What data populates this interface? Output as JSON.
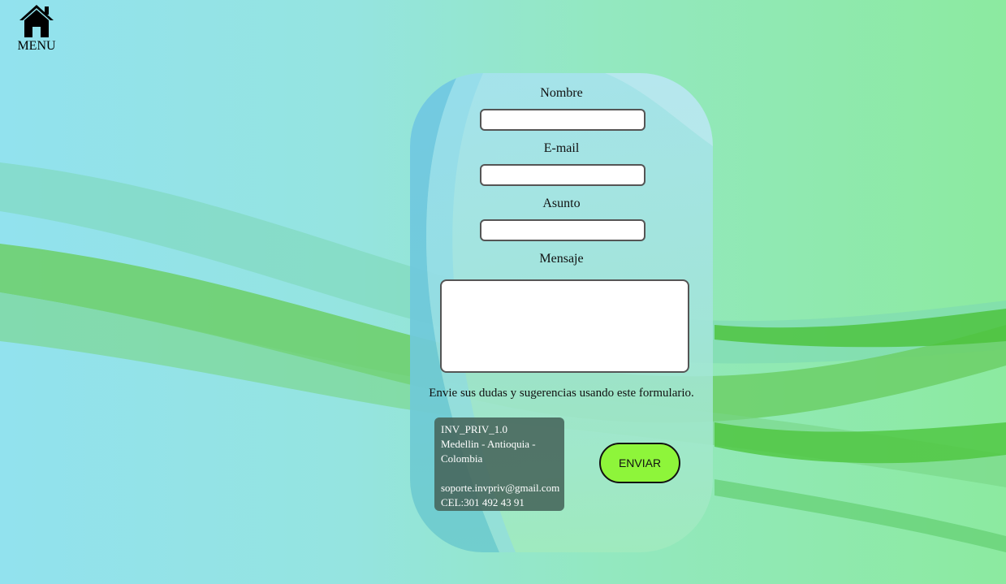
{
  "nav": {
    "home_icon": "home-icon",
    "menu_label": "MENU"
  },
  "form": {
    "name_label": "Nombre",
    "name_value": "",
    "email_label": "E-mail",
    "email_value": "",
    "subject_label": "Asunto",
    "subject_value": "",
    "message_label": "Mensaje",
    "message_value": "",
    "hint": "Envie sus dudas y sugerencias usando este formulario.",
    "submit_label": "ENVIAR"
  },
  "info": {
    "app_name": "INV_PRIV_1.0",
    "location": "Medellin - Antioquia - Colombia",
    "email": "soporte.invpriv@gmail.com",
    "phone": "CEL:301 492 43 91"
  },
  "colors": {
    "submit_button": "#8ef53a",
    "info_box": "#46645a"
  }
}
